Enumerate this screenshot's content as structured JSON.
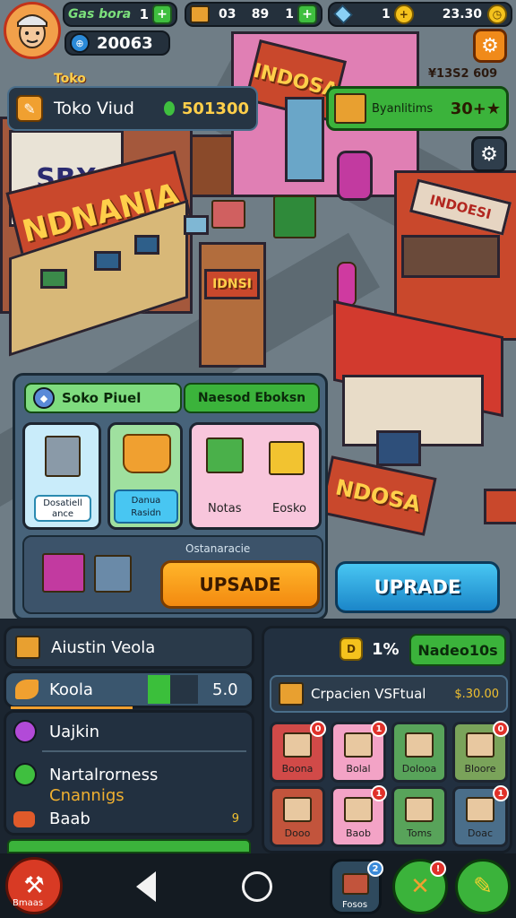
{
  "topbar": {
    "player_name": "Gas bora",
    "player_level": "1",
    "crates_count": "03",
    "boxes_count": "89",
    "gems_count": "1",
    "time": "23.30",
    "balance": "20063",
    "corner_stat": "¥13S2 609"
  },
  "store": {
    "name": "Toko Viud",
    "label_top": "Toko",
    "value": "501300"
  },
  "goal": {
    "label": "Byanlitims",
    "value": "30+★"
  },
  "signs": {
    "main": "NDNANIA",
    "left": "SBX",
    "top": "INDOSA",
    "right": "INDOESI",
    "front": "NDOSA",
    "small": "IDNSI"
  },
  "shop_panel": {
    "tab_left": "Soko Piuel",
    "tab_right": "Naesod Eboksn",
    "cards": [
      {
        "label": "Dosatiell ance"
      },
      {
        "label": "Danua Rasidn"
      },
      {
        "label": "Notas"
      },
      {
        "label": "Eosko"
      }
    ],
    "section_label": "Ostanaracie",
    "upgrade_orange": "UPSADE",
    "upgrade_blue": "UPRADE"
  },
  "stats_panel": {
    "title": "Aiustin Veola",
    "rows": [
      {
        "label": "Koola",
        "value": "5.0"
      },
      {
        "label": "Uajkin",
        "value": ""
      },
      {
        "label": "Nartalrorness",
        "value": ""
      },
      {
        "label": "Cnannigs",
        "value": ""
      },
      {
        "label": "Baab",
        "value": "9"
      }
    ],
    "progress": 0.45
  },
  "inventory_panel": {
    "percent": "1%",
    "tab": "Nadeo10s",
    "subtitle": "Crpacien VSFtual",
    "subtitle_value": "$.30.00",
    "items": [
      {
        "label": "Boona",
        "badge": "0",
        "color": "#d14a48"
      },
      {
        "label": "Bolal",
        "badge": "1",
        "color": "#f3a3c6"
      },
      {
        "label": "Dolooa",
        "badge": "",
        "color": "#58a35a"
      },
      {
        "label": "Bloore",
        "badge": "0",
        "color": "#7aa35a"
      },
      {
        "label": "Dooo",
        "badge": "",
        "color": "#c2543c"
      },
      {
        "label": "Baob",
        "badge": "1",
        "color": "#f3a3c6"
      },
      {
        "label": "Toms",
        "badge": "",
        "color": "#58a35a"
      },
      {
        "label": "Doac",
        "badge": "1",
        "color": "#4a6e8a"
      }
    ]
  },
  "bottom_nav": {
    "left_label": "Bmaas",
    "middle_label": "Fosos"
  }
}
